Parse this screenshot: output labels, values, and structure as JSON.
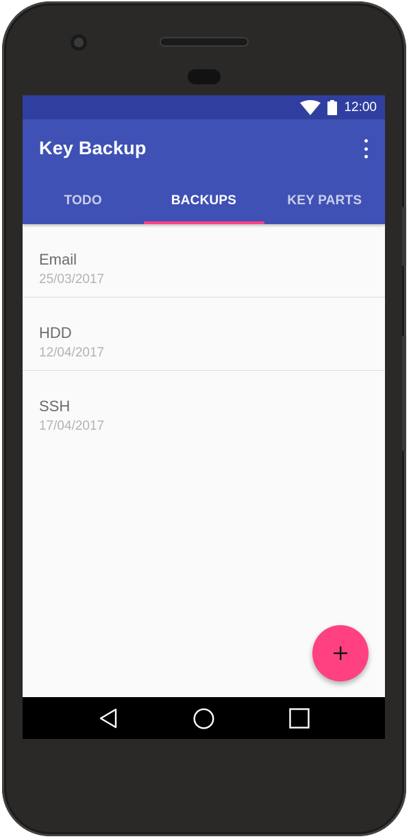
{
  "status_bar": {
    "time": "12:00",
    "wifi_icon": "wifi-icon",
    "battery_icon": "battery-icon"
  },
  "app_bar": {
    "title": "Key Backup",
    "overflow_icon": "more-vert-icon"
  },
  "tabs": [
    {
      "label": "TODO",
      "selected": false
    },
    {
      "label": "BACKUPS",
      "selected": true
    },
    {
      "label": "KEY PARTS",
      "selected": false
    }
  ],
  "backups": [
    {
      "name": "Email",
      "date": "25/03/2017"
    },
    {
      "name": "HDD",
      "date": "12/04/2017"
    },
    {
      "name": "SSH",
      "date": "17/04/2017"
    }
  ],
  "fab": {
    "icon": "add-icon"
  },
  "nav_bar": {
    "back_icon": "back-icon",
    "home_icon": "home-icon",
    "recents_icon": "recents-icon"
  },
  "colors": {
    "primary": "#3f51b5",
    "primary_dark": "#303f9f",
    "accent": "#ff4081",
    "background": "#fafafa"
  }
}
